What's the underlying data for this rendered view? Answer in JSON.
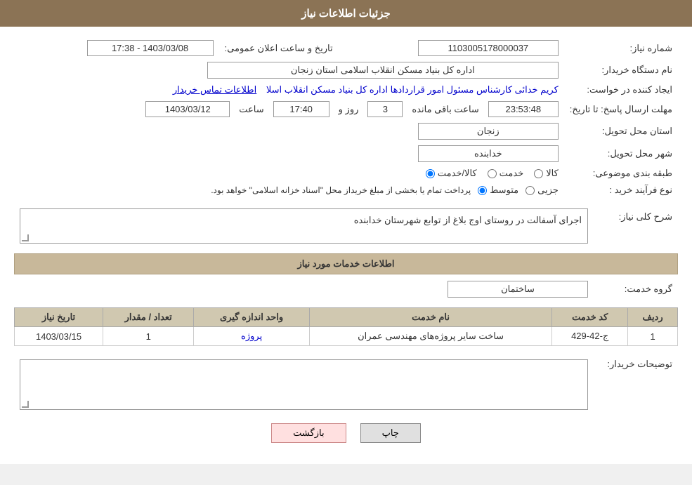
{
  "header": {
    "title": "جزئیات اطلاعات نیاز"
  },
  "fields": {
    "need_number_label": "شماره نیاز:",
    "need_number_value": "1103005178000037",
    "announce_date_label": "تاریخ و ساعت اعلان عمومی:",
    "announce_date_value": "1403/03/08 - 17:38",
    "buyer_org_label": "نام دستگاه خریدار:",
    "buyer_org_value": "اداره کل بنیاد مسکن انقلاب اسلامی استان زنجان",
    "creator_label": "ایجاد کننده در خواست:",
    "creator_value": "کریم خدائی کارشناس مسئول امور قراردادها اداره کل بنیاد مسکن انقلاب اسلا",
    "contact_link": "اطلاعات تماس خریدار",
    "reply_deadline_label": "مهلت ارسال پاسخ: تا تاریخ:",
    "reply_date": "1403/03/12",
    "reply_time": "17:40",
    "reply_days": "3",
    "reply_remaining": "23:53:48",
    "reply_date_label": "ساعت",
    "reply_days_label": "روز و",
    "reply_remaining_label": "ساعت باقی مانده",
    "province_label": "استان محل تحویل:",
    "province_value": "زنجان",
    "city_label": "شهر محل تحویل:",
    "city_value": "خدابنده",
    "category_label": "طبقه بندی موضوعی:",
    "category_options": [
      "کالا",
      "خدمت",
      "کالا/خدمت"
    ],
    "category_selected": "کالا/خدمت",
    "purchase_type_label": "نوع فرآیند خرید :",
    "purchase_type_options": [
      "جزیی",
      "متوسط"
    ],
    "purchase_type_note": "پرداخت تمام یا بخشی از مبلغ خریداز محل \"اسناد خزانه اسلامی\" خواهد بود.",
    "purchase_type_selected": "متوسط"
  },
  "need_description": {
    "section_title": "شرح کلی نیاز:",
    "description": "اجرای آسفالت در روستای  اوج بلاغ از توابع شهرستان خدابنده"
  },
  "services_section": {
    "section_title": "اطلاعات خدمات مورد نیاز",
    "group_label": "گروه خدمت:",
    "group_value": "ساختمان",
    "table": {
      "columns": [
        "ردیف",
        "کد خدمت",
        "نام خدمت",
        "واحد اندازه گیری",
        "تعداد / مقدار",
        "تاریخ نیاز"
      ],
      "rows": [
        {
          "row": "1",
          "code": "ج-42-429",
          "name": "ساخت سایر پروژه‌های مهندسی عمران",
          "unit": "پروژه",
          "quantity": "1",
          "date": "1403/03/15"
        }
      ]
    }
  },
  "buyer_notes": {
    "label": "توضیحات خریدار:",
    "value": ""
  },
  "buttons": {
    "print": "چاپ",
    "back": "بازگشت"
  }
}
